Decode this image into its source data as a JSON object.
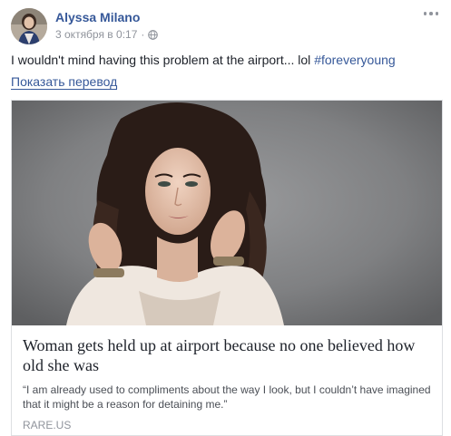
{
  "post": {
    "author": "Alyssa Milano",
    "timestamp": "3 октября в 0:17",
    "separator": "·",
    "privacy_icon": "globe-icon",
    "more_icon": "more-options-icon",
    "text": "I wouldn't mind having this problem at the airport... lol ",
    "hashtag": "#foreveryoung",
    "translate_label": "Показать перевод"
  },
  "link_card": {
    "image_alt": "woman-portrait",
    "title": "Woman gets held up at airport because no one believed how old she was",
    "description": "“I am already used to compliments about the way I look, but I couldn’t have imagined that it might be a reason for detaining me.”",
    "source": "RARE.US"
  },
  "colors": {
    "link": "#365899",
    "text": "#1d2129",
    "meta": "#90949c",
    "border": "#dddfe2"
  }
}
